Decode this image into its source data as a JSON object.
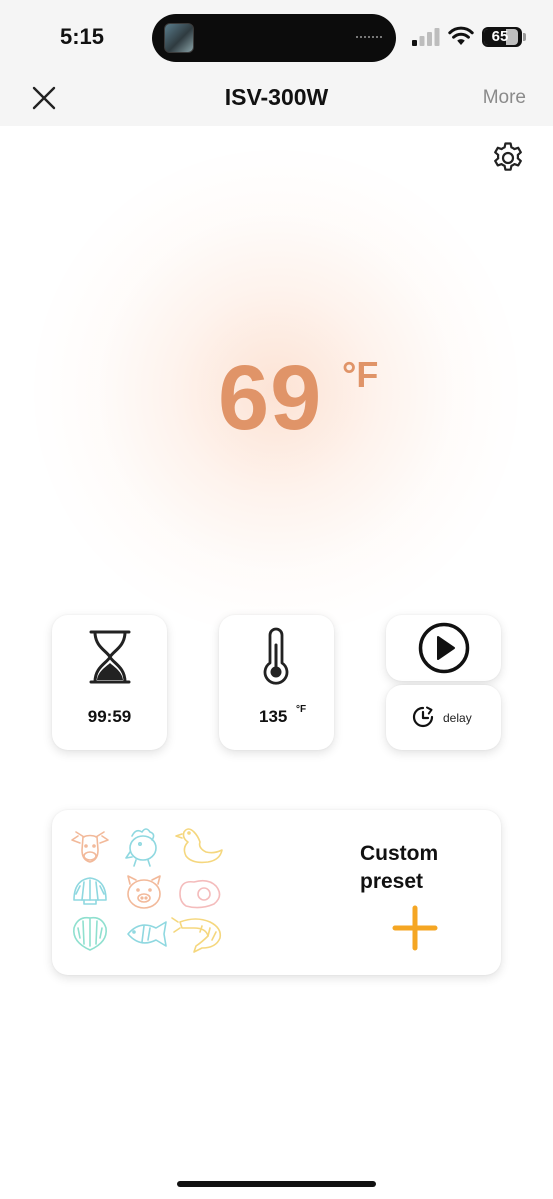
{
  "status_bar": {
    "time": "5:15",
    "battery_level": "65",
    "icons": [
      "signal-icon",
      "wifi-icon",
      "battery-icon"
    ]
  },
  "nav": {
    "close_icon": "close-icon",
    "title": "ISV-300W",
    "more_label": "More"
  },
  "settings_icon": "gear-icon",
  "current_temperature": {
    "value": "69",
    "unit": "°F"
  },
  "controls": {
    "timer": {
      "icon": "hourglass-icon",
      "value": "99:59"
    },
    "target_temperature": {
      "icon": "thermometer-icon",
      "value": "135",
      "unit": "°F"
    },
    "start": {
      "icon": "play-icon"
    },
    "delay": {
      "icon": "clock-delay-icon",
      "label": "delay"
    }
  },
  "preset": {
    "title_line1": "Custom",
    "title_line2": "preset",
    "icons": [
      "cow-icon",
      "chicken-icon",
      "duck-icon",
      "shell-icon",
      "pig-icon",
      "egg-icon",
      "clam-icon",
      "fish-icon",
      "shrimp-icon"
    ],
    "add_icon": "plus-icon"
  },
  "colors": {
    "accent": "#e09468",
    "plus": "#f5a623",
    "background": "#ffffff",
    "nav_background": "#f5f5f5"
  }
}
